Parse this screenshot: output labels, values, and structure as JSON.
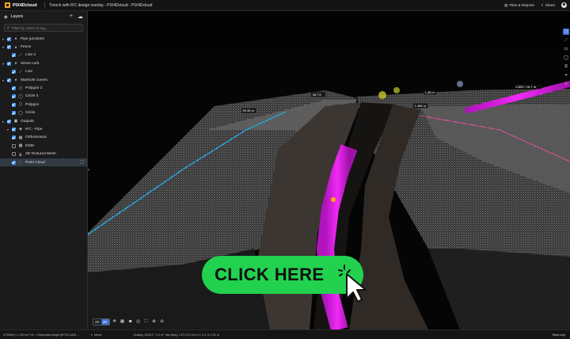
{
  "header": {
    "app_name": "PIX4Dcloud",
    "project_title": "Trench with IFC design overlay - PIX4Dcloud - PIX4Dcloud",
    "files_reports": "Files & Reports",
    "share": "Share"
  },
  "panel": {
    "title": "Layers",
    "search_placeholder": "Filter by name or tag...",
    "layers": [
      {
        "label": "Pipe junctions",
        "level": 0,
        "checked": true,
        "icon": "tag-icon",
        "expand": true
      },
      {
        "label": "Fence",
        "level": 0,
        "checked": true,
        "icon": "tag-icon",
        "expand": true
      },
      {
        "label": "Line 2",
        "level": 1,
        "checked": true,
        "icon": "line-icon"
      },
      {
        "label": "Street curb",
        "level": 0,
        "checked": true,
        "icon": "tag-icon",
        "expand": true
      },
      {
        "label": "Line",
        "level": 1,
        "checked": true,
        "icon": "line-icon"
      },
      {
        "label": "Manhole covers",
        "level": 0,
        "checked": true,
        "icon": "tag-icon",
        "expand": true
      },
      {
        "label": "Polygon 2",
        "level": 1,
        "checked": true,
        "icon": "polygon-icon"
      },
      {
        "label": "Circle 2",
        "level": 1,
        "checked": true,
        "icon": "circle-icon"
      },
      {
        "label": "Polygon",
        "level": 1,
        "checked": true,
        "icon": "polygon-icon"
      },
      {
        "label": "Circle",
        "level": 1,
        "checked": true,
        "icon": "circle-icon"
      },
      {
        "label": "Outputs",
        "level": 0,
        "checked": true,
        "icon": "folder-icon",
        "expand": true
      },
      {
        "label": "IFC - Pipe",
        "level": 1,
        "checked": true,
        "icon": "ifc-icon",
        "expand": true
      },
      {
        "label": "Orthomosaic",
        "level": 1,
        "checked": true,
        "icon": "grid-icon"
      },
      {
        "label": "DSM",
        "level": 1,
        "checked": false,
        "icon": "grid-icon"
      },
      {
        "label": "3D Textured Mesh",
        "level": 1,
        "checked": false,
        "icon": "mesh-icon"
      },
      {
        "label": "Point Cloud",
        "level": 1,
        "checked": true,
        "icon": "pointcloud-icon",
        "active": true
      }
    ]
  },
  "viewport": {
    "view_2d": "2D",
    "view_3d": "3D",
    "measure_labels": [
      "50.38 m",
      "38.7 ft",
      "1.45 m",
      "1.456 m",
      "0.853 / 16.7 m"
    ]
  },
  "status": {
    "coords": "4730609 | 1.789 km² 10+ 1 Ellipsoidal height (EPSG:4326 ...",
    "units": "Metric",
    "scale": "Scaling: 4925.0°, 0.0 m°  Yaw tiltng: 1.47 0.0 0.53 m   0 -2.1 % 1.51 m",
    "state": "Read only"
  },
  "cta": {
    "label": "CLICK HERE"
  },
  "colors": {
    "accent": "#3a6fd8",
    "cta_green": "#22d24f",
    "ifc_pipe": "#e01ee6",
    "street_line": "#2aa0d8"
  }
}
